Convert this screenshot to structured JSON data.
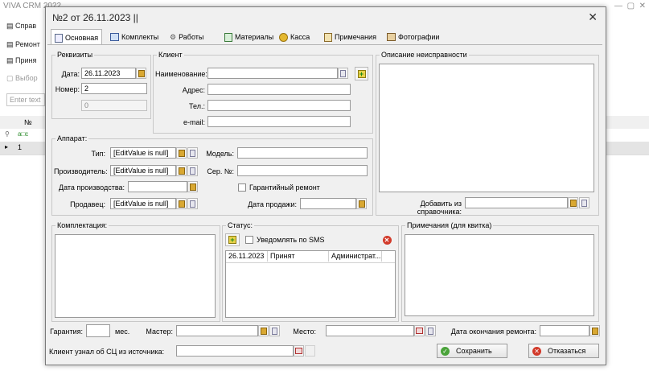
{
  "background": {
    "app_title": "VIVA CRM 2022",
    "toolbar": [
      "Справ",
      "Ремонт",
      "Приня",
      "Выбор"
    ],
    "search_placeholder": "Enter text",
    "grid_header": "№",
    "rows": [
      "1"
    ]
  },
  "dialog": {
    "title": "№2 от 26.11.2023 ||",
    "close": "✕",
    "tabs": [
      {
        "label": "Основная",
        "icon": "document-icon"
      },
      {
        "label": "Комплекты",
        "icon": "table-icon"
      },
      {
        "label": "Работы",
        "icon": "gear-icon"
      },
      {
        "label": "Материалы",
        "icon": "materials-icon"
      },
      {
        "label": "Касса",
        "icon": "coins-icon"
      },
      {
        "label": "Примечания",
        "icon": "notes-icon"
      },
      {
        "label": "Фотографии",
        "icon": "photo-icon"
      }
    ],
    "requisites": {
      "title": "Реквизиты",
      "date_label": "Дата:",
      "date_value": "26.11.2023",
      "number_label": "Номер:",
      "number_value": "2",
      "counter_value": "0"
    },
    "client": {
      "title": "Клиент",
      "name_label": "Наименование:",
      "address_label": "Адрес:",
      "phone_label": "Тел.:",
      "email_label": "e-mail:"
    },
    "fault": {
      "title": "Описание неисправности",
      "add_label": "Добавить из справочника:"
    },
    "device": {
      "title": "Аппарат:",
      "type_label": "Тип:",
      "type_value": "[EditValue is null]",
      "manufacturer_label": "Производитель:",
      "manufacturer_value": "[EditValue is null]",
      "production_date_label": "Дата производства:",
      "seller_label": "Продавец:",
      "seller_value": "[EditValue is null]",
      "model_label": "Модель:",
      "serial_label": "Сер. №:",
      "warranty_label": "Гарантийный ремонт",
      "sale_date_label": "Дата продажи:"
    },
    "kit": {
      "title": "Комплектация:"
    },
    "status": {
      "title": "Статус:",
      "sms_label": "Уведомлять по SMS",
      "rows": [
        {
          "date": "26.11.2023",
          "status": "Принят",
          "user": "Администрат..."
        }
      ]
    },
    "receipt_notes": {
      "title": "Примечания (для квитка)"
    },
    "bottom": {
      "warranty_label": "Гарантия:",
      "months_label": "мес.",
      "master_label": "Мастер:",
      "place_label": "Место:",
      "repair_end_label": "Дата окончания ремонта:",
      "source_label": "Клиент узнал об СЦ из источника:",
      "save_label": "Сохранить",
      "cancel_label": "Отказаться"
    }
  }
}
